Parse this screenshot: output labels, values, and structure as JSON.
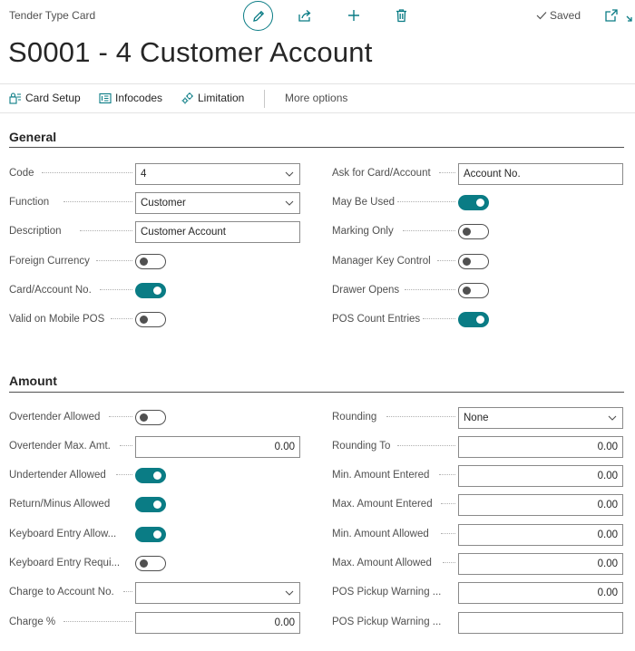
{
  "header": {
    "caption": "Tender Type Card",
    "saved_label": "Saved",
    "title": "S0001 - 4 Customer Account",
    "accent": "#0a7c85"
  },
  "icons": {
    "edit": "pencil-icon",
    "share": "share-icon",
    "add": "plus-icon",
    "delete": "trash-icon",
    "popout": "open-in-new-window-icon",
    "collapse": "collapse-icon"
  },
  "actions": {
    "card_setup": "Card Setup",
    "infocodes": "Infocodes",
    "limitation": "Limitation",
    "more_options": "More options"
  },
  "general": {
    "title": "General",
    "code_label": "Code",
    "code_value": "4",
    "function_label": "Function",
    "function_value": "Customer",
    "description_label": "Description",
    "description_value": "Customer Account",
    "foreign_currency_label": "Foreign Currency",
    "foreign_currency": false,
    "card_account_no_label": "Card/Account No.",
    "card_account_no": true,
    "valid_mobile_label": "Valid on Mobile POS",
    "valid_mobile": false,
    "ask_card_label": "Ask for Card/Account",
    "ask_card_value": "Account No.",
    "may_be_used_label": "May Be Used",
    "may_be_used": true,
    "marking_only_label": "Marking Only",
    "marking_only": false,
    "manager_key_label": "Manager Key Control",
    "manager_key": false,
    "drawer_opens_label": "Drawer Opens",
    "drawer_opens": false,
    "pos_count_label": "POS Count Entries",
    "pos_count": true
  },
  "amount": {
    "title": "Amount",
    "overtender_allowed_label": "Overtender Allowed",
    "overtender_allowed": false,
    "overtender_max_label": "Overtender Max. Amt.",
    "overtender_max_value": "0.00",
    "undertender_label": "Undertender Allowed",
    "undertender": true,
    "return_minus_label": "Return/Minus Allowed",
    "return_minus": true,
    "keyboard_allowed_label": "Keyboard Entry Allow...",
    "keyboard_allowed": true,
    "keyboard_required_label": "Keyboard Entry Requi...",
    "keyboard_required": false,
    "charge_account_label": "Charge to Account No.",
    "charge_account_value": "",
    "charge_pct_label": "Charge %",
    "charge_pct_value": "0.00",
    "rounding_label": "Rounding",
    "rounding_value": "None",
    "rounding_to_label": "Rounding To",
    "rounding_to_value": "0.00",
    "min_entered_label": "Min. Amount Entered",
    "min_entered_value": "0.00",
    "max_entered_label": "Max. Amount Entered",
    "max_entered_value": "0.00",
    "min_allowed_label": "Min. Amount Allowed",
    "min_allowed_value": "0.00",
    "max_allowed_label": "Max. Amount Allowed",
    "max_allowed_value": "0.00",
    "pickup_warning1_label": "POS Pickup Warning ...",
    "pickup_warning1_value": "0.00",
    "pickup_warning2_label": "POS Pickup Warning ...",
    "pickup_warning2_value": ""
  }
}
